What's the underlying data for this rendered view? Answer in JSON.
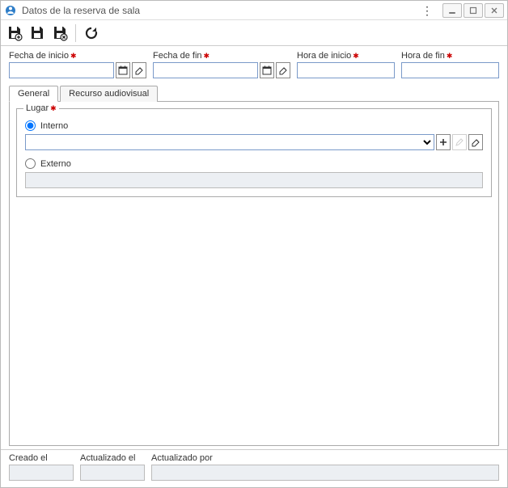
{
  "window": {
    "title": "Datos de la reserva de sala"
  },
  "fields": {
    "fecha_inicio": {
      "label": "Fecha de inicio",
      "value": ""
    },
    "fecha_fin": {
      "label": "Fecha de fin",
      "value": ""
    },
    "hora_inicio": {
      "label": "Hora de inicio",
      "value": ""
    },
    "hora_fin": {
      "label": "Hora de fin",
      "value": ""
    }
  },
  "tabs": {
    "general": "General",
    "recurso": "Recurso audiovisual"
  },
  "lugar": {
    "legend": "Lugar",
    "interno_label": "Interno",
    "externo_label": "Externo",
    "combo_value": "",
    "externo_value": ""
  },
  "footer": {
    "creado_el": {
      "label": "Creado el",
      "value": ""
    },
    "actualizado_el": {
      "label": "Actualizado el",
      "value": ""
    },
    "actualizado_por": {
      "label": "Actualizado por",
      "value": ""
    }
  }
}
